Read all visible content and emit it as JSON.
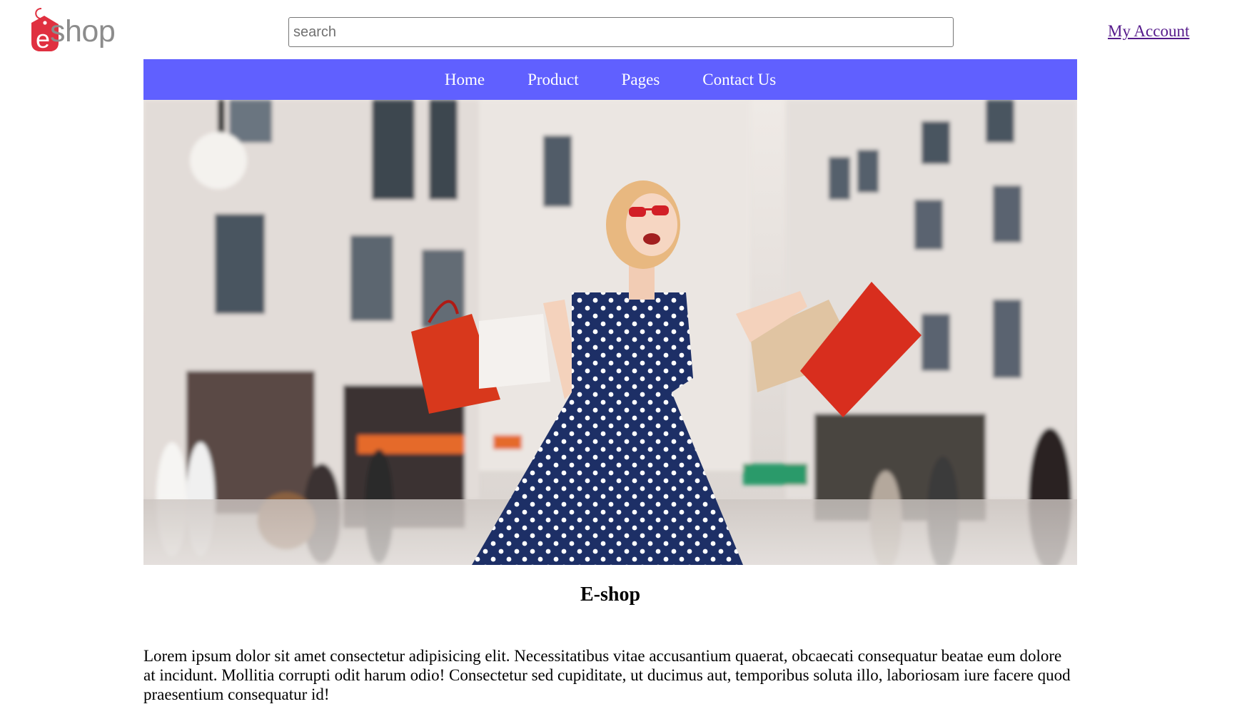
{
  "header": {
    "logo_text": "shop",
    "search_placeholder": "search",
    "search_value": "",
    "account_link": "My Account"
  },
  "nav": {
    "items": [
      {
        "label": "Home"
      },
      {
        "label": "Product"
      },
      {
        "label": "Pages"
      },
      {
        "label": "Contact Us"
      }
    ]
  },
  "main": {
    "title": "E-shop",
    "paragraph": "Lorem ipsum dolor sit amet consectetur adipisicing elit. Necessitatibus vitae accusantium quaerat, obcaecati consequatur beatae eum dolore at incidunt. Mollitia corrupti odit harum odio! Consectetur sed cupiditate, ut ducimus aut, temporibus soluta illo, laboriosam iure facere quod praesentium consequatur id!"
  },
  "colors": {
    "nav_background": "#6060ff",
    "logo_red": "#e03040",
    "logo_gray": "#8c8c8c",
    "link_visited": "#551a8b"
  }
}
